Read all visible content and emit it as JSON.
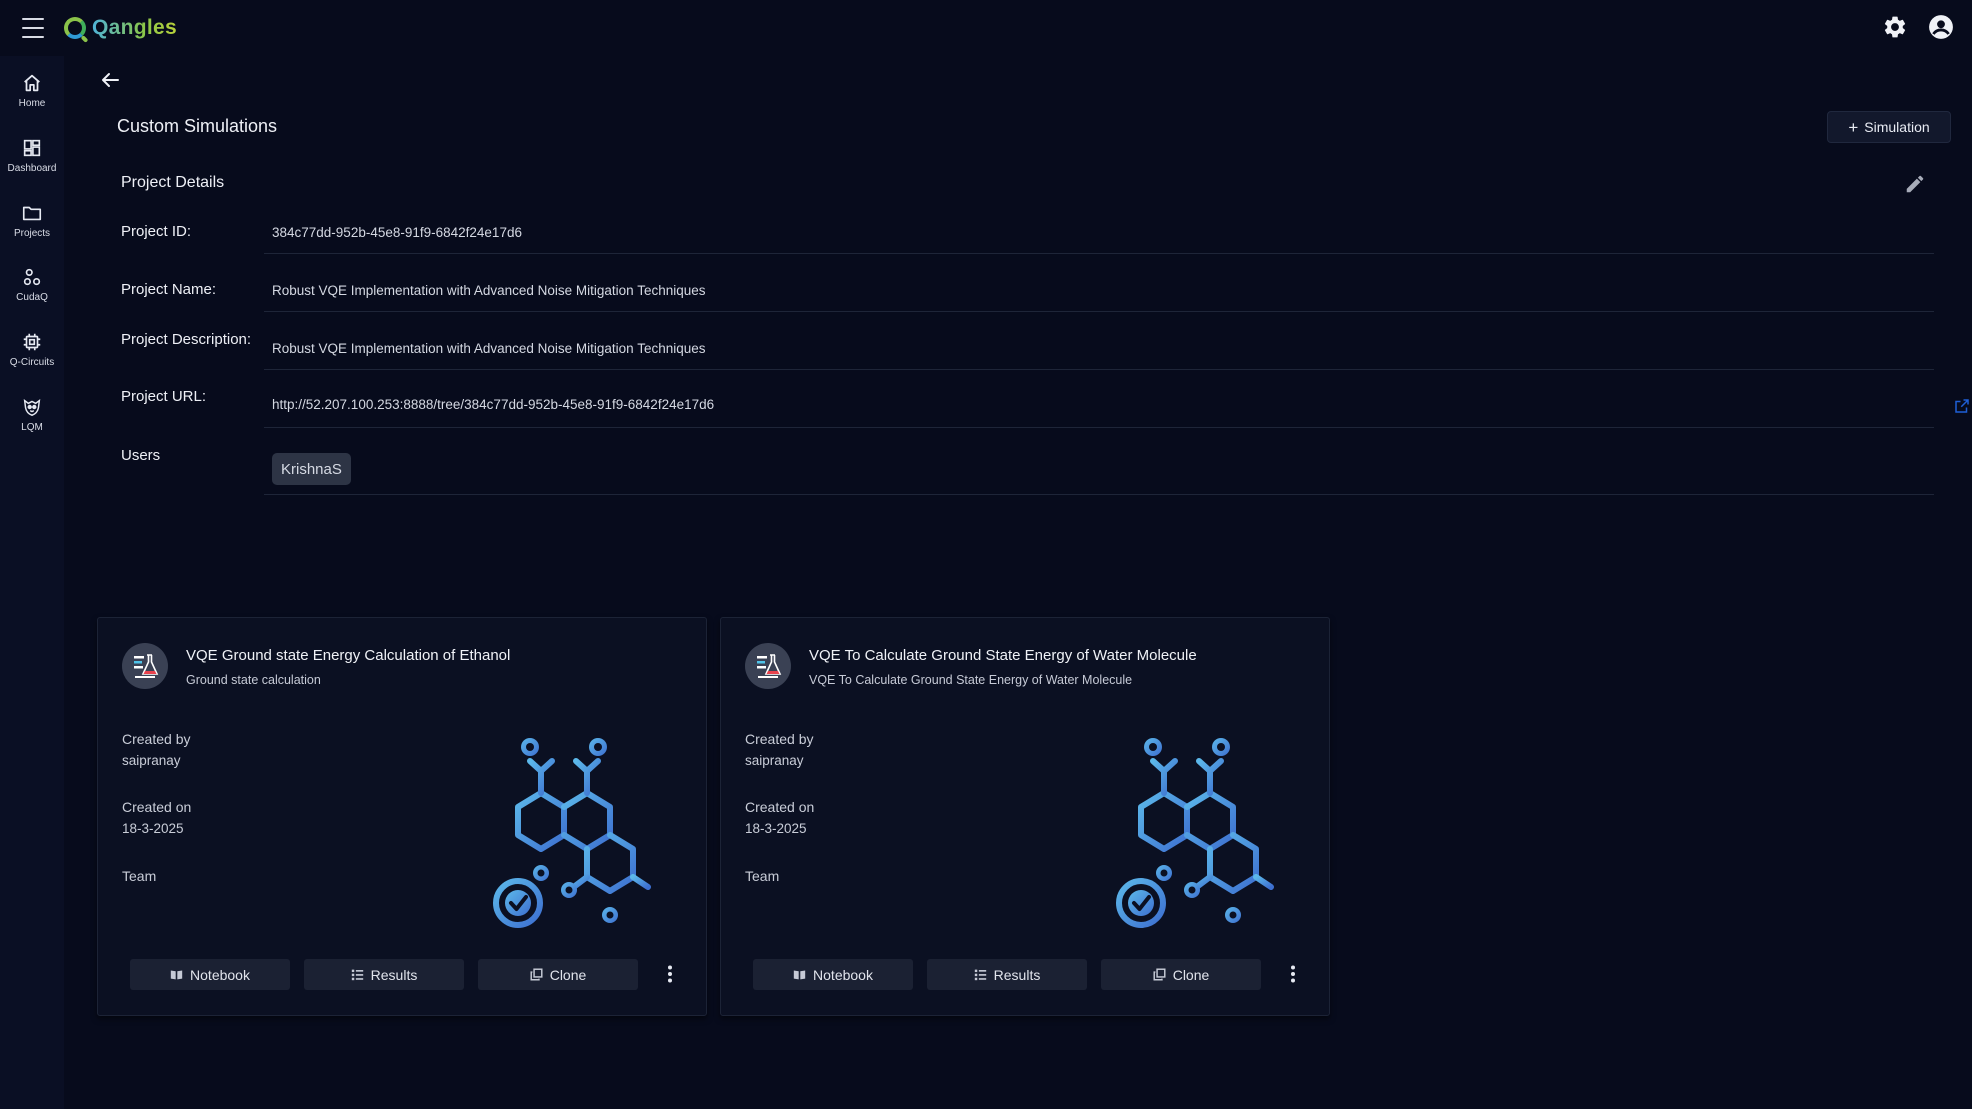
{
  "app": {
    "logo_text": "Qangles"
  },
  "sidebar": {
    "items": [
      {
        "label": "Home",
        "icon": "home-icon"
      },
      {
        "label": "Dashboard",
        "icon": "dashboard-icon"
      },
      {
        "label": "Projects",
        "icon": "folder-icon"
      },
      {
        "label": "CudaQ",
        "icon": "cudaq-icon"
      },
      {
        "label": "Q-Circuits",
        "icon": "chip-icon"
      },
      {
        "label": "LQM",
        "icon": "lqm-icon"
      }
    ]
  },
  "header": {
    "title": "Custom Simulations",
    "add_button_label": "Simulation"
  },
  "project": {
    "section_title": "Project Details",
    "id_label": "Project ID:",
    "id_value": "384c77dd-952b-45e8-91f9-6842f24e17d6",
    "name_label": "Project Name:",
    "name_value": "Robust VQE Implementation with Advanced Noise Mitigation Techniques",
    "description_label": "Project Description:",
    "description_value": "Robust VQE Implementation with Advanced Noise Mitigation Techniques",
    "url_label": "Project URL:",
    "url_value": "http://52.207.100.253:8888/tree/384c77dd-952b-45e8-91f9-6842f24e17d6",
    "users_label": "Users",
    "users": [
      "KrishnaS"
    ]
  },
  "cards": [
    {
      "title": "VQE Ground state Energy Calculation of Ethanol",
      "subtitle": "Ground state calculation",
      "created_by_label": "Created by",
      "created_by": "saipranay",
      "created_on_label": "Created on",
      "created_on": "18-3-2025",
      "team_label": "Team",
      "notebook_label": "Notebook",
      "results_label": "Results",
      "clone_label": "Clone"
    },
    {
      "title": "VQE To Calculate Ground State Energy of Water Molecule",
      "subtitle": "VQE To Calculate Ground State Energy of Water Molecule",
      "created_by_label": "Created by",
      "created_by": "saipranay",
      "created_on_label": "Created on",
      "created_on": "18-3-2025",
      "team_label": "Team",
      "notebook_label": "Notebook",
      "results_label": "Results",
      "clone_label": "Clone"
    }
  ],
  "colors": {
    "background": "#070b1c",
    "sidebar": "#0a0f24",
    "card": "#0b1022",
    "accent_blue": "#3d7fd6",
    "link_icon": "#1f5fd6"
  }
}
